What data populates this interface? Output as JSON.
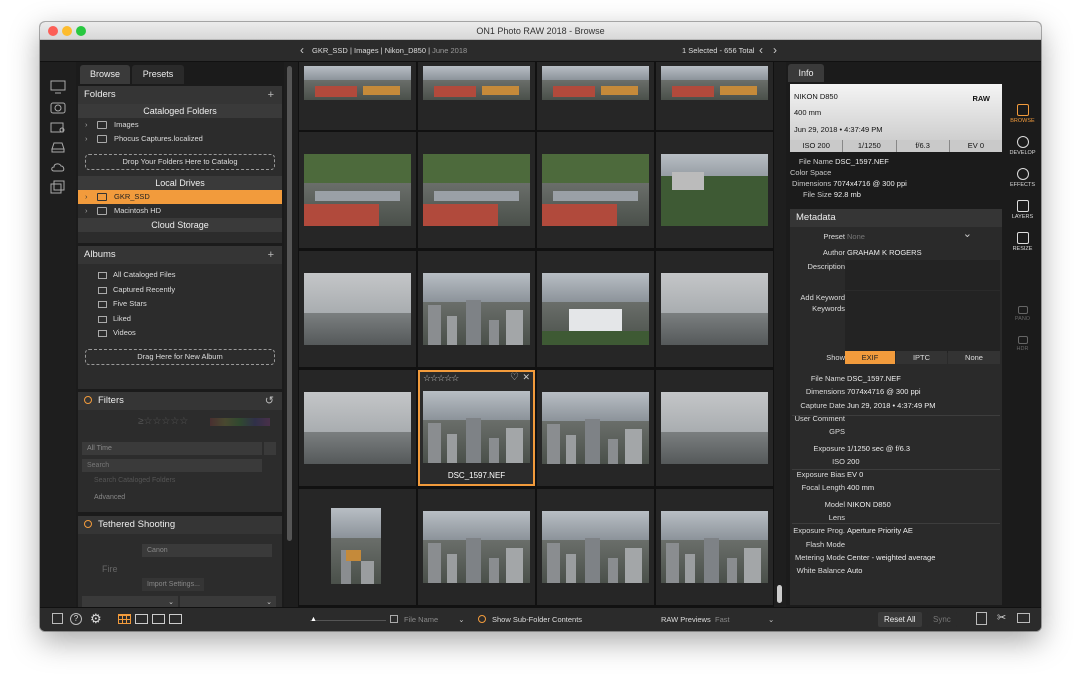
{
  "window": {
    "title": "ON1 Photo RAW 2018 - Browse"
  },
  "nav": {
    "crumb_drive": "GKR_SSD",
    "crumb_folder1": "Images",
    "crumb_folder2": "Nikon_D850",
    "crumb_folder3": "June 2018",
    "selection": "1 Selected - 656 Total"
  },
  "left_tabs": {
    "browse": "Browse",
    "presets": "Presets"
  },
  "folders": {
    "title": "Folders",
    "cataloged_title": "Cataloged Folders",
    "cataloged": [
      "Images",
      "Phocus Captures.localized"
    ],
    "drop_folders": "Drop Your Folders Here to Catalog",
    "local_title": "Local Drives",
    "local": [
      "GKR_SSD",
      "Macintosh HD"
    ],
    "cloud_title": "Cloud Storage"
  },
  "albums": {
    "title": "Albums",
    "items": [
      "All Cataloged Files",
      "Captured Recently",
      "Five Stars",
      "Liked",
      "Videos"
    ],
    "drop_album": "Drag Here for New Album"
  },
  "filters": {
    "title": "Filters",
    "date": "All Time",
    "search_placeholder": "Search",
    "search_catalog": "Search Cataloged Folders",
    "advanced": "Advanced"
  },
  "tethered": {
    "title": "Tethered Shooting",
    "camera": "Canon",
    "fire": "Fire",
    "import": "Import Settings..."
  },
  "grid": {
    "selected_file": "DSC_1597.NEF",
    "selected_stars": "☆☆☆☆☆"
  },
  "info": {
    "tab": "Info",
    "camera": "NIKON D850",
    "format": "RAW",
    "focal": "400 mm",
    "date": "Jun 29, 2018 • 4:37:49 PM",
    "iso": "ISO 200",
    "shutter": "1/1250",
    "aperture": "f/6.3",
    "ev": "EV 0",
    "file_name_label": "File Name",
    "file_name": "DSC_1597.NEF",
    "color_space_label": "Color Space",
    "dimensions_label": "Dimensions",
    "dimensions": "7074x4716 @ 300 ppi",
    "file_size_label": "File Size",
    "file_size": "92.8 mb"
  },
  "metadata": {
    "title": "Metadata",
    "preset_label": "Preset",
    "preset": "None",
    "author_label": "Author",
    "author": "GRAHAM K ROGERS",
    "description_label": "Description",
    "keyword_label": "Add Keyword",
    "keywords_label": "Keywords",
    "show_label": "Show",
    "show_options": [
      "EXIF",
      "IPTC",
      "None"
    ],
    "exif": [
      {
        "k": "File Name",
        "v": "DSC_1597.NEF"
      },
      {
        "k": "Dimensions",
        "v": "7074x4716 @ 300 ppi"
      },
      {
        "k": "Capture Date",
        "v": "Jun 29, 2018 • 4:37:49 PM"
      },
      {
        "k": "User Comment",
        "v": ""
      },
      {
        "k": "GPS",
        "v": ""
      },
      {
        "k": "Exposure",
        "v": "1/1250 sec @ f/6.3"
      },
      {
        "k": "ISO",
        "v": "200"
      },
      {
        "k": "Exposure Bias",
        "v": "EV 0"
      },
      {
        "k": "Focal Length",
        "v": "400 mm"
      },
      {
        "k": "Model",
        "v": "NIKON D850"
      },
      {
        "k": "Lens",
        "v": ""
      },
      {
        "k": "Exposure Prog.",
        "v": "Aperture Priority AE"
      },
      {
        "k": "Flash Mode",
        "v": ""
      },
      {
        "k": "Metering Mode",
        "v": "Center - weighted average"
      },
      {
        "k": "White Balance",
        "v": "Auto"
      }
    ]
  },
  "modules": [
    "BROWSE",
    "DEVELOP",
    "EFFECTS",
    "LAYERS",
    "RESIZE",
    "PANO",
    "HDR"
  ],
  "bottom": {
    "sort": "File Name",
    "subfolder": "Show Sub-Folder Contents",
    "raw_label": "RAW Previews",
    "raw_value": "Fast",
    "reset": "Reset All",
    "sync": "Sync"
  },
  "colors": {
    "accent": "#f29b3c",
    "panel": "#2c2c2c",
    "background": "#1b1b1b"
  }
}
